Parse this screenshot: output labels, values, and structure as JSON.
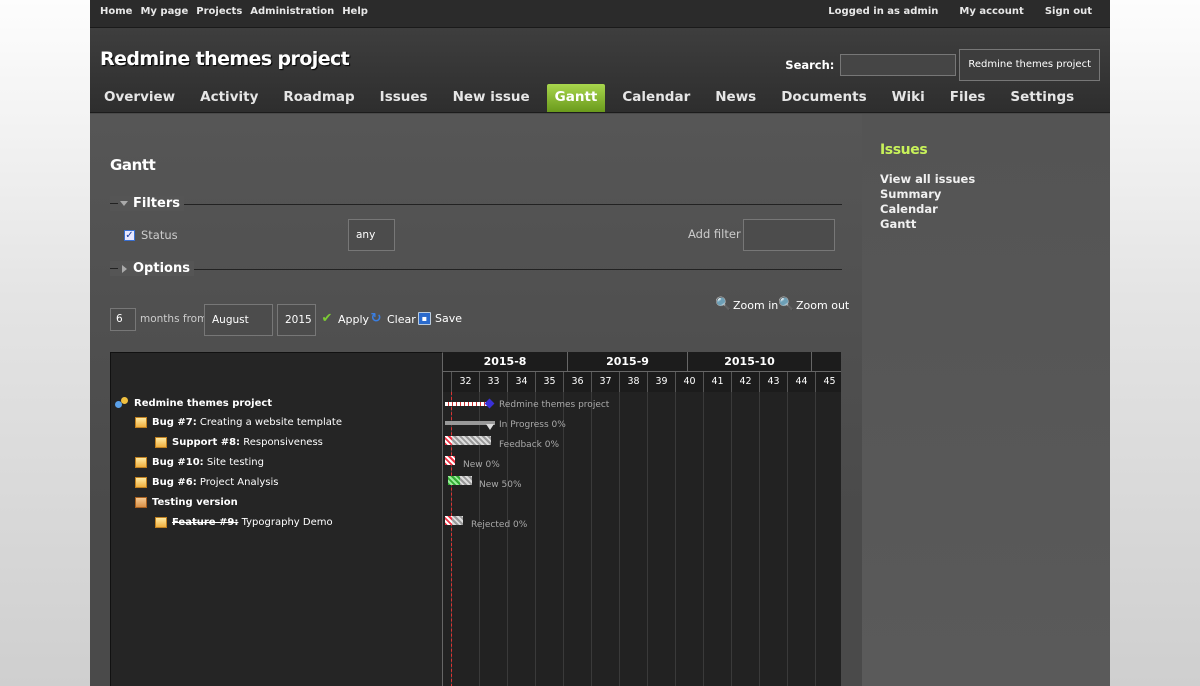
{
  "top_menu": {
    "left": [
      "Home",
      "My page",
      "Projects",
      "Administration",
      "Help"
    ],
    "logged_in": "Logged in as admin",
    "my_account": "My account",
    "sign_out": "Sign out"
  },
  "header": {
    "title": "Redmine themes project",
    "search_label": "Search:",
    "search_value": "",
    "project_jump": "Redmine themes project"
  },
  "main_menu": {
    "tabs": [
      "Overview",
      "Activity",
      "Roadmap",
      "Issues",
      "New issue",
      "Gantt",
      "Calendar",
      "News",
      "Documents",
      "Wiki",
      "Files",
      "Settings"
    ],
    "selected": "Gantt"
  },
  "page": {
    "title": "Gantt",
    "filters_legend": "Filters",
    "status_label": "Status",
    "status_value": "any",
    "add_filter_label": "Add filter",
    "options_legend": "Options",
    "months_value": "6",
    "months_from_label": "months from",
    "month_value": "August",
    "year_value": "2015",
    "apply_label": "Apply",
    "clear_label": "Clear",
    "save_label": "Save",
    "zoom_in_label": "Zoom in",
    "zoom_out_label": "Zoom out"
  },
  "gantt": {
    "months": [
      "2015-8",
      "2015-9",
      "2015-10"
    ],
    "weeks": [
      "32",
      "33",
      "34",
      "35",
      "36",
      "37",
      "38",
      "39",
      "40",
      "41",
      "42",
      "43",
      "44",
      "45"
    ],
    "rows": [
      {
        "type": "project",
        "prefix": "",
        "subject": "Redmine themes project",
        "bar_label": "Redmine themes project"
      },
      {
        "type": "issue",
        "prefix": "Bug #7:",
        "subject": "Creating a website template",
        "bar_label": "In Progress 0%"
      },
      {
        "type": "issue",
        "prefix": "Support #8:",
        "subject": "Responsiveness",
        "bar_label": "Feedback 0%"
      },
      {
        "type": "issue",
        "prefix": "Bug #10:",
        "subject": "Site testing",
        "bar_label": "New 0%"
      },
      {
        "type": "issue",
        "prefix": "Bug #6:",
        "subject": "Project Analysis",
        "bar_label": "New 50%"
      },
      {
        "type": "version",
        "prefix": "",
        "subject": "Testing version",
        "bar_label": ""
      },
      {
        "type": "issue",
        "prefix": "Feature #9:",
        "subject": "Typography Demo",
        "bar_label": "Rejected 0%",
        "closed": true
      }
    ],
    "done_ratio_bug6": 50
  },
  "sidebar": {
    "title": "Issues",
    "links": [
      "View all issues",
      "Summary",
      "Calendar",
      "Gantt"
    ]
  },
  "colors": {
    "accent": "#a8d64d",
    "sidebar_title": "#c8f25a",
    "late": "#ee3344",
    "done": "#33aa33"
  }
}
